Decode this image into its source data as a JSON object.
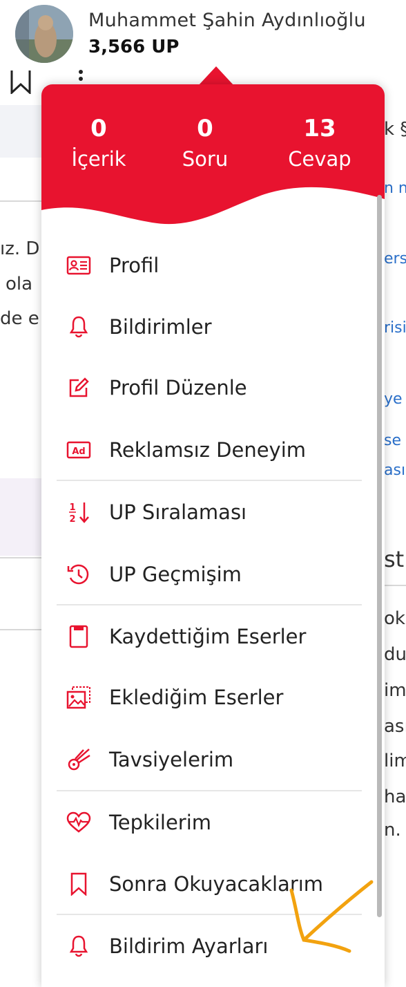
{
  "header": {
    "user_name": "Muhammet Şahin Aydınlıoğlu",
    "user_points": "3,566 UP"
  },
  "background": {
    "text_lines": [
      "ız. D",
      "olа",
      "de e"
    ],
    "link_fragments": [
      "n n",
      "ers",
      "risi",
      "ye",
      "se",
      "ası"
    ],
    "right_heading": "st",
    "right_lines": [
      "ok",
      "duğ",
      "im",
      "ası",
      "lim",
      "ha",
      "n."
    ],
    "top_right": "k §"
  },
  "stats": {
    "items": [
      {
        "count": "0",
        "label": "İçerik"
      },
      {
        "count": "0",
        "label": "Soru"
      },
      {
        "count": "13",
        "label": "Cevap"
      }
    ]
  },
  "menu": {
    "items": [
      {
        "label": "Profil",
        "icon": "profile-card-icon"
      },
      {
        "label": "Bildirimler",
        "icon": "bell-icon"
      },
      {
        "label": "Profil Düzenle",
        "icon": "edit-icon"
      },
      {
        "label": "Reklamsız Deneyim",
        "icon": "ad-icon"
      },
      {
        "label": "UP Sıralaması",
        "icon": "sort-icon"
      },
      {
        "label": "UP Geçmişim",
        "icon": "history-icon"
      },
      {
        "label": "Kaydettiğim Eserler",
        "icon": "saved-card-icon"
      },
      {
        "label": "Eklediğim Eserler",
        "icon": "gallery-icon"
      },
      {
        "label": "Tavsiyelerim",
        "icon": "comet-icon"
      },
      {
        "label": "Tepkilerim",
        "icon": "heart-pulse-icon"
      },
      {
        "label": "Sonra Okuyacaklarım",
        "icon": "bookmark-icon"
      },
      {
        "label": "Bildirim Ayarları",
        "icon": "bell-settings-icon"
      }
    ]
  },
  "colors": {
    "accent": "#e8132f",
    "annotation": "#f2a20f"
  }
}
